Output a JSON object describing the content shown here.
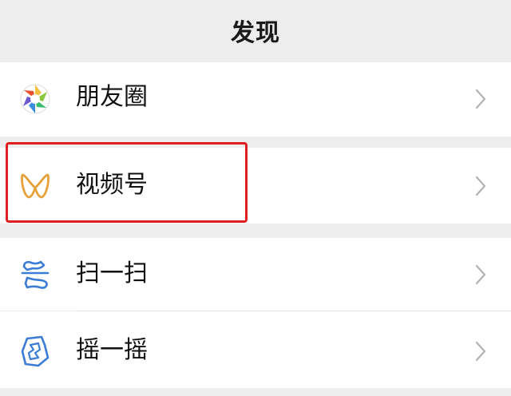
{
  "header": {
    "title": "发现"
  },
  "items": [
    {
      "label": "朋友圈",
      "icon": "moments-aperture-icon"
    },
    {
      "label": "视频号",
      "icon": "channels-butterfly-icon"
    },
    {
      "label": "扫一扫",
      "icon": "scan-icon"
    },
    {
      "label": "摇一摇",
      "icon": "shake-icon"
    }
  ],
  "colors": {
    "background": "#ededed",
    "row_background": "#ffffff",
    "highlight": "#e02020",
    "channels_icon": "#e8a13a",
    "scan_icon": "#3b7cd6",
    "chevron": "#b2b2b2"
  },
  "annotation": {
    "highlighted_item": "视频号"
  }
}
